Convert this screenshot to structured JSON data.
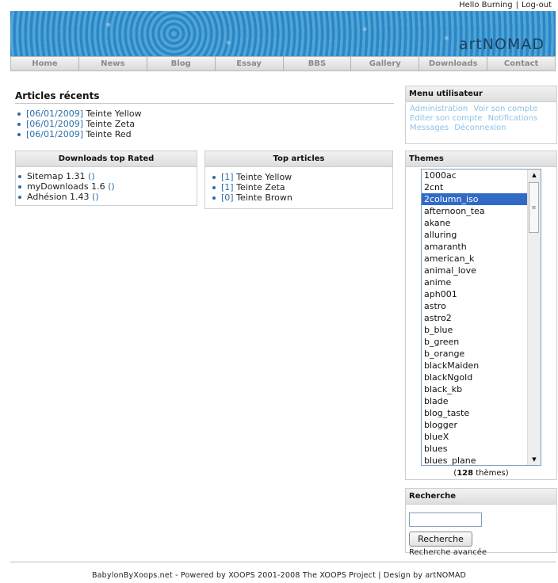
{
  "userbar": {
    "greeting": "Hello Burning",
    "separator": "|",
    "logout": "Log-out"
  },
  "banner": {
    "logo_text": "artNOMAD"
  },
  "nav": {
    "items": [
      "Home",
      "News",
      "Blog",
      "Essay",
      "BBS",
      "Gallery",
      "Downloads",
      "Contact"
    ]
  },
  "articles": {
    "title": "Articles récents",
    "items": [
      {
        "date": "[06/01/2009]",
        "title": "Teinte Yellow"
      },
      {
        "date": "[06/01/2009]",
        "title": "Teinte Zeta"
      },
      {
        "date": "[06/01/2009]",
        "title": "Teinte Red"
      }
    ]
  },
  "downloads": {
    "title": "Downloads top Rated",
    "items": [
      {
        "name": "Sitemap 1.31",
        "extra": "()"
      },
      {
        "name": "myDownloads 1.6",
        "extra": "()"
      },
      {
        "name": "Adhésion 1.43",
        "extra": "()"
      }
    ]
  },
  "top_articles": {
    "title": "Top articles",
    "items": [
      {
        "count": "[1]",
        "title": "Teinte Yellow"
      },
      {
        "count": "[1]",
        "title": "Teinte Zeta"
      },
      {
        "count": "[0]",
        "title": "Teinte Brown"
      }
    ]
  },
  "user_menu": {
    "title": "Menu utilisateur",
    "links": [
      "Administration",
      "Voir son compte",
      "Editer son compte",
      "Notifications",
      "Messages",
      "Déconnexion"
    ]
  },
  "themes": {
    "title": "Themes",
    "options": [
      "1000ac",
      "2cnt",
      "2column_iso",
      "afternoon_tea",
      "akane",
      "alluring",
      "amaranth",
      "american_k",
      "animal_love",
      "anime",
      "aph001",
      "astro",
      "astro2",
      "b_blue",
      "b_green",
      "b_orange",
      "blackMaiden",
      "blackNgold",
      "black_kb",
      "blade",
      "blog_taste",
      "blogger",
      "blueX",
      "blues",
      "blues_plane"
    ],
    "selected": "2column_iso",
    "count_prefix": "(",
    "count": "128",
    "count_suffix": " thèmes)"
  },
  "search": {
    "title": "Recherche",
    "input_value": "",
    "button_label": "Recherche",
    "advanced_link": "Recherche avancée"
  },
  "footer": {
    "text": "BabylonByXoops.net - Powered by XOOPS 2001-2008 The XOOPS Project  |  Design by artNOMAD"
  },
  "colors": {
    "link": "#2a6da8",
    "selected": "#316ac5",
    "user_menu_link": "#8cc3e8"
  }
}
